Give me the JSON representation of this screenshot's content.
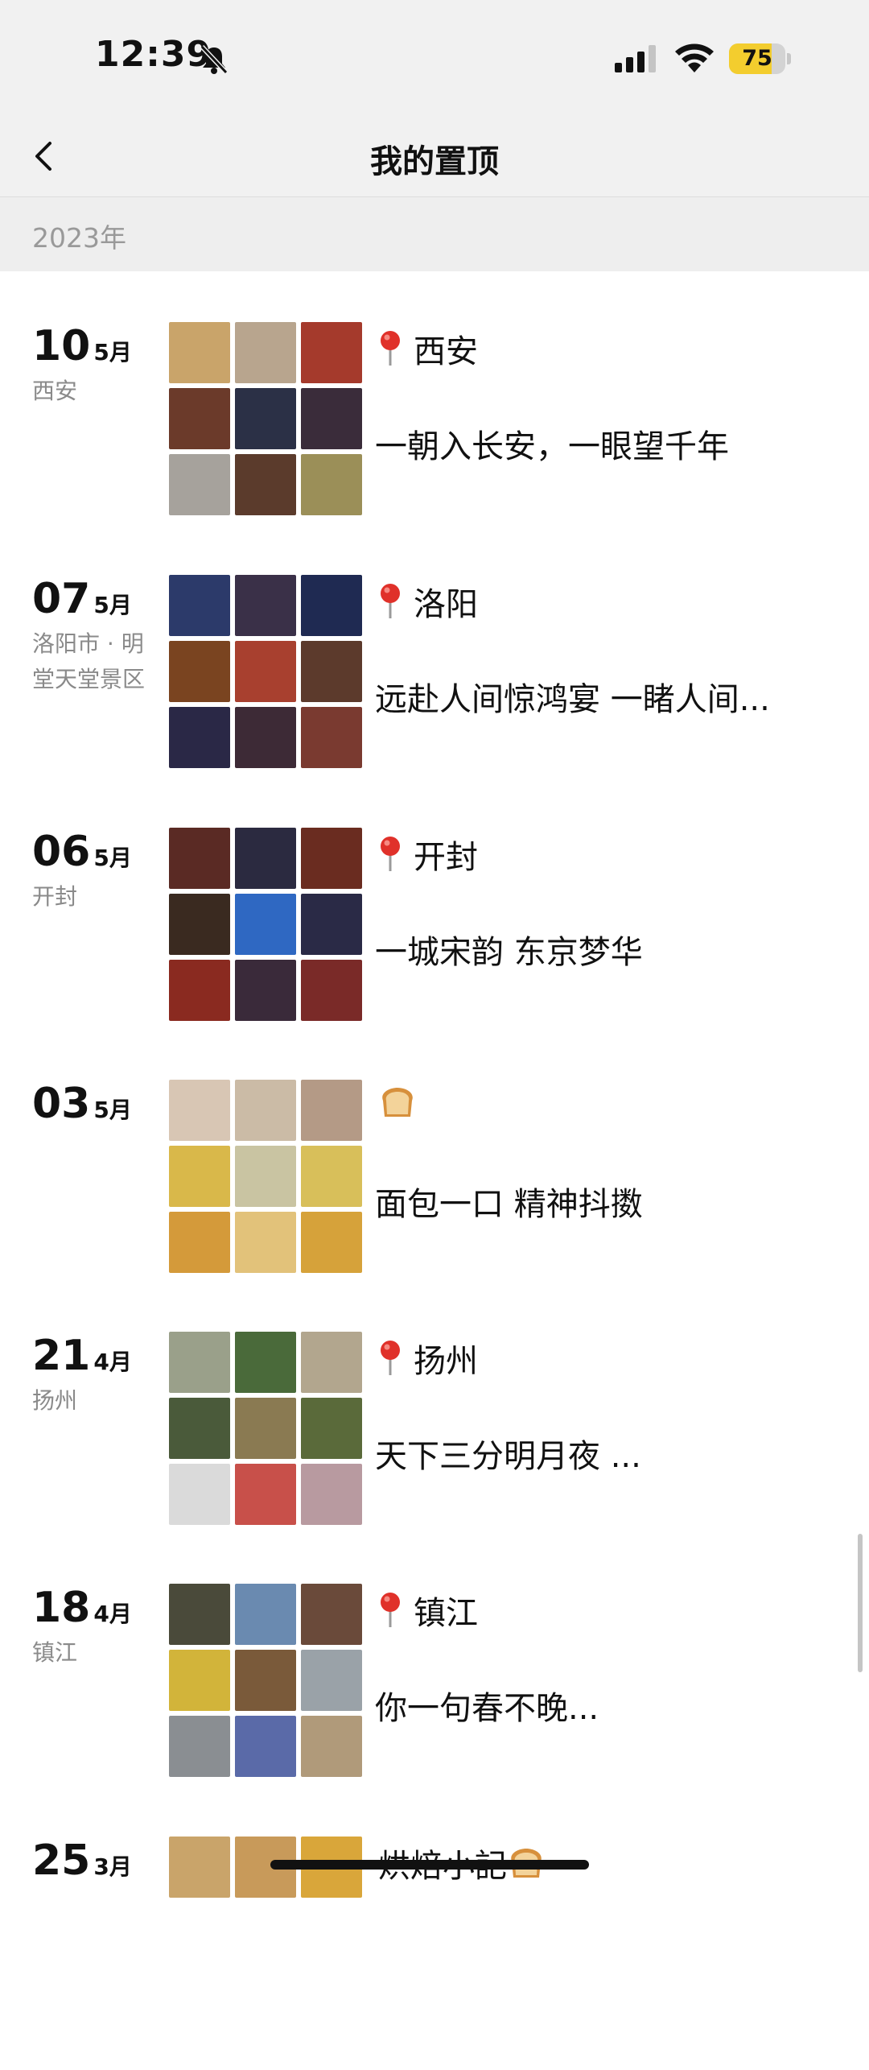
{
  "status_bar": {
    "time": "12:39",
    "battery_level": "75",
    "battery_fraction": 0.75,
    "battery_color": "#f3cd2e"
  },
  "nav": {
    "title": "我的置顶"
  },
  "year_header": "2023年",
  "entries": [
    {
      "day": "10",
      "month": "5月",
      "place": "西安",
      "location": "西安",
      "caption": "一朝入长安，一眼望千年",
      "icon": "pin-icon",
      "thumbs": [
        "#c9a46a",
        "#b8a58e",
        "#a53a2c",
        "#6b3a2a",
        "#2b3046",
        "#3a2c3a",
        "#a6a29c",
        "#5b3b2c",
        "#9b8f58"
      ]
    },
    {
      "day": "07",
      "month": "5月",
      "place": "洛阳市 · 明堂天堂景区",
      "location": "洛阳",
      "caption": "远赴人间惊鸿宴 一睹人间...",
      "icon": "pin-icon",
      "thumbs": [
        "#2c3a6a",
        "#3a3048",
        "#1f2a52",
        "#7a4420",
        "#a8402f",
        "#5c3a2c",
        "#2a2846",
        "#3d2a36",
        "#7a3a30"
      ]
    },
    {
      "day": "06",
      "month": "5月",
      "place": "开封",
      "location": "开封",
      "caption": "一城宋韵 东京梦华",
      "icon": "pin-icon",
      "thumbs": [
        "#5a2a24",
        "#2b2a40",
        "#6a2c20",
        "#3a2a20",
        "#2f68c2",
        "#2a2a46",
        "#8a2a20",
        "#3a2a3a",
        "#7a2a28"
      ]
    },
    {
      "day": "03",
      "month": "5月",
      "place": "",
      "location": "",
      "caption": "面包一口 精神抖擞",
      "icon": "bread-icon",
      "thumbs": [
        "#d8c6b4",
        "#cbbba6",
        "#b49a86",
        "#d9b84a",
        "#c9c4a2",
        "#d8bf5a",
        "#d49a3a",
        "#e2c27a",
        "#d6a23a"
      ]
    },
    {
      "day": "21",
      "month": "4月",
      "place": "扬州",
      "location": "扬州",
      "caption": "天下三分明月夜 ...",
      "icon": "pin-icon",
      "thumbs": [
        "#9aa08a",
        "#4a6a3a",
        "#b2a68e",
        "#4a5a3a",
        "#8a7a52",
        "#5a6a3a",
        "#dadada",
        "#c8504a",
        "#b89aa0"
      ]
    },
    {
      "day": "18",
      "month": "4月",
      "place": "镇江",
      "location": "镇江",
      "caption": "你一句春不晚...",
      "icon": "pin-icon",
      "thumbs": [
        "#4a4a3a",
        "#6a8ab0",
        "#6a4a3a",
        "#d2b43a",
        "#7a5a3a",
        "#9aa2a8",
        "#8a8e92",
        "#5a6aa8",
        "#b09a7a"
      ]
    },
    {
      "day": "25",
      "month": "3月",
      "place": "",
      "location": "烘焙小記",
      "caption": "",
      "icon": "bread-icon",
      "thumbs": [
        "#c9a46a",
        "#c89a5a",
        "#d9a63a"
      ]
    }
  ]
}
